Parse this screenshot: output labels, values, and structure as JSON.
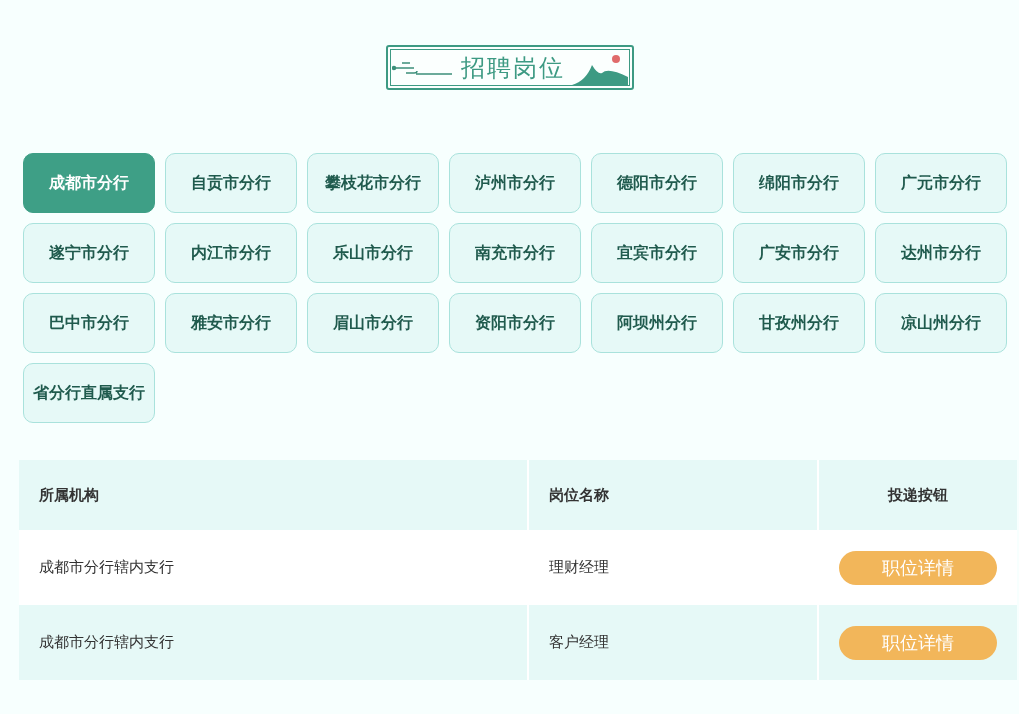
{
  "banner": {
    "title": "招聘岗位"
  },
  "branches": [
    {
      "label": "成都市分行",
      "selected": true
    },
    {
      "label": "自贡市分行",
      "selected": false
    },
    {
      "label": "攀枝花市分行",
      "selected": false
    },
    {
      "label": "泸州市分行",
      "selected": false
    },
    {
      "label": "德阳市分行",
      "selected": false
    },
    {
      "label": "绵阳市分行",
      "selected": false
    },
    {
      "label": "广元市分行",
      "selected": false
    },
    {
      "label": "遂宁市分行",
      "selected": false
    },
    {
      "label": "内江市分行",
      "selected": false
    },
    {
      "label": "乐山市分行",
      "selected": false
    },
    {
      "label": "南充市分行",
      "selected": false
    },
    {
      "label": "宜宾市分行",
      "selected": false
    },
    {
      "label": "广安市分行",
      "selected": false
    },
    {
      "label": "达州市分行",
      "selected": false
    },
    {
      "label": "巴中市分行",
      "selected": false
    },
    {
      "label": "雅安市分行",
      "selected": false
    },
    {
      "label": "眉山市分行",
      "selected": false
    },
    {
      "label": "资阳市分行",
      "selected": false
    },
    {
      "label": "阿坝州分行",
      "selected": false
    },
    {
      "label": "甘孜州分行",
      "selected": false
    },
    {
      "label": "凉山州分行",
      "selected": false
    },
    {
      "label": "省分行直属支行",
      "selected": false
    }
  ],
  "table": {
    "columns": [
      "所属机构",
      "岗位名称",
      "投递按钮"
    ],
    "rows": [
      {
        "institution": "成都市分行辖内支行",
        "position": "理财经理",
        "button": "职位详情"
      },
      {
        "institution": "成都市分行辖内支行",
        "position": "客户经理",
        "button": "职位详情"
      }
    ]
  }
}
